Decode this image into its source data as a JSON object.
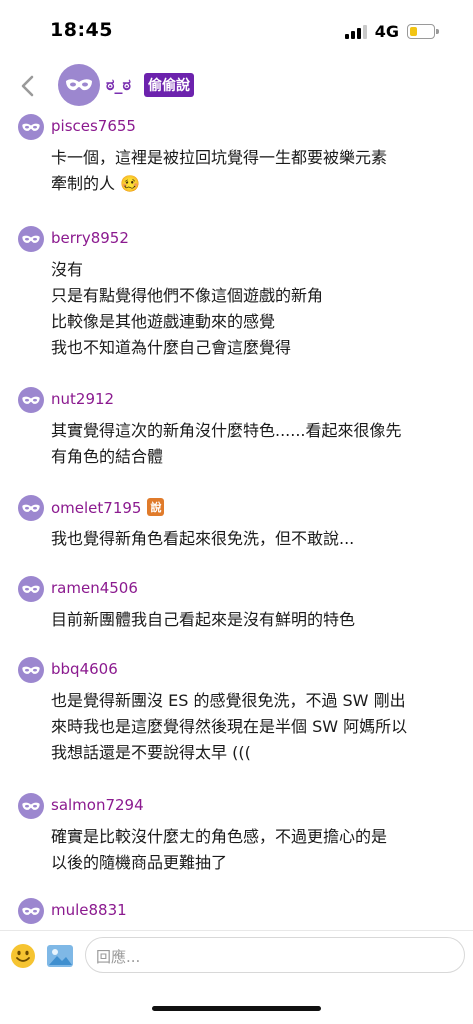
{
  "status_bar": {
    "time": "18:45",
    "network": "4G",
    "battery_level": 0.3
  },
  "header": {
    "name": "ಠ_ಠ",
    "tag": "偷偷說"
  },
  "comments": [
    {
      "username": "pisces7655",
      "lines": [
        "卡一個，這裡是被拉回坑覺得一生都要被樂元素",
        "牽制的人 🥴"
      ]
    },
    {
      "username": "berry8952",
      "lines": [
        "沒有",
        "只是有點覺得他們不像這個遊戲的新角",
        "比較像是其他遊戲連動來的感覺",
        "我也不知道為什麼自己會這麼覺得"
      ]
    },
    {
      "username": "nut2912",
      "lines": [
        "其實覺得這次的新角沒什麼特色......看起來很像先",
        "有角色的結合體"
      ]
    },
    {
      "username": "omelet7195",
      "badge": "說",
      "lines": [
        "我也覺得新角色看起來很免洗，但不敢說..."
      ]
    },
    {
      "username": "ramen4506",
      "lines": [
        "目前新團體我自己看起來是沒有鮮明的特色"
      ]
    },
    {
      "username": "bbq4606",
      "lines": [
        "也是覺得新團沒 ES 的感覺很免洗，不過 SW 剛出",
        "來時我也是這麼覺得然後現在是半個 SW 阿媽所以",
        "我想話還是不要說得太早 ((("
      ]
    },
    {
      "username": "salmon7294",
      "lines": [
        "確實是比較沒什麼ㄤ的角色感，不過更擔心的是",
        "以後的隨機商品更難抽了"
      ]
    },
    {
      "username": "mule8831",
      "lines": []
    }
  ],
  "input": {
    "placeholder": "回應..."
  }
}
